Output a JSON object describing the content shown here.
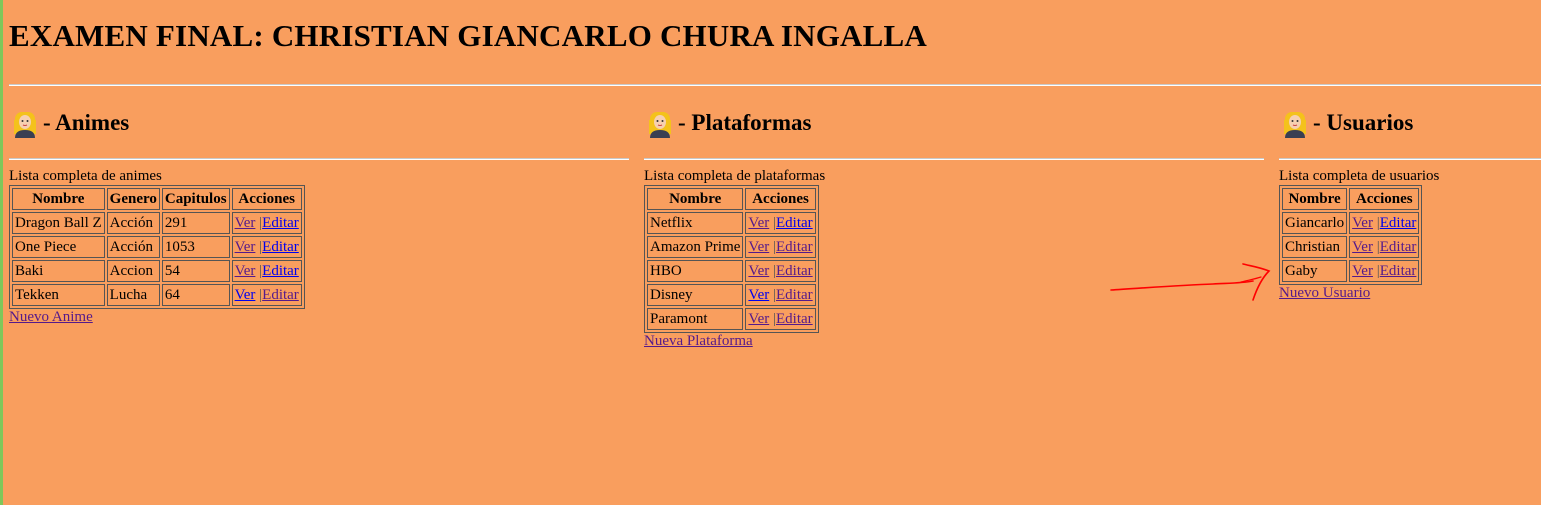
{
  "page": {
    "title": "EXAMEN FINAL: CHRISTIAN GIANCARLO CHURA INGALLA"
  },
  "animes": {
    "heading": "- Animes",
    "list_label": "Lista completa de animes",
    "columns": [
      "Nombre",
      "Genero",
      "Capitulos",
      "Acciones"
    ],
    "rows": [
      {
        "nombre": "Dragon Ball Z",
        "genero": "Acción",
        "capitulos": "291",
        "ver": "Ver",
        "editar": "Editar"
      },
      {
        "nombre": "One Piece",
        "genero": "Acción",
        "capitulos": "1053",
        "ver": "Ver",
        "editar": "Editar"
      },
      {
        "nombre": "Baki",
        "genero": "Accion",
        "capitulos": "54",
        "ver": "Ver",
        "editar": "Editar"
      },
      {
        "nombre": "Tekken",
        "genero": "Lucha",
        "capitulos": "64",
        "ver": "Ver",
        "editar": "Editar"
      }
    ],
    "new_link": "Nuevo Anime"
  },
  "plataformas": {
    "heading": "- Plataformas",
    "list_label": "Lista completa de plataformas",
    "columns": [
      "Nombre",
      "Acciones"
    ],
    "rows": [
      {
        "nombre": "Netflix",
        "ver": "Ver",
        "editar": "Editar"
      },
      {
        "nombre": "Amazon Prime",
        "ver": "Ver",
        "editar": "Editar"
      },
      {
        "nombre": "HBO",
        "ver": "Ver",
        "editar": "Editar"
      },
      {
        "nombre": "Disney",
        "ver": "Ver",
        "editar": "Editar"
      },
      {
        "nombre": "Paramont",
        "ver": "Ver",
        "editar": "Editar"
      }
    ],
    "new_link": "Nueva Plataforma"
  },
  "usuarios": {
    "heading": "- Usuarios",
    "list_label": "Lista completa de usuarios",
    "columns": [
      "Nombre",
      "Acciones"
    ],
    "rows": [
      {
        "nombre": "Giancarlo",
        "ver": "Ver",
        "editar": "Editar"
      },
      {
        "nombre": "Christian",
        "ver": "Ver",
        "editar": "Editar"
      },
      {
        "nombre": "Gaby",
        "ver": "Ver",
        "editar": "Editar"
      }
    ],
    "new_link": "Nuevo Usuario"
  },
  "colors": {
    "background": "#f99e5e",
    "link": "#0000ee",
    "visited_link": "#551a8b",
    "annotation_arrow": "#ff0000"
  },
  "icons": {
    "section_icon": "woman-emoji-icon",
    "annotation": "red-arrow-annotation"
  }
}
